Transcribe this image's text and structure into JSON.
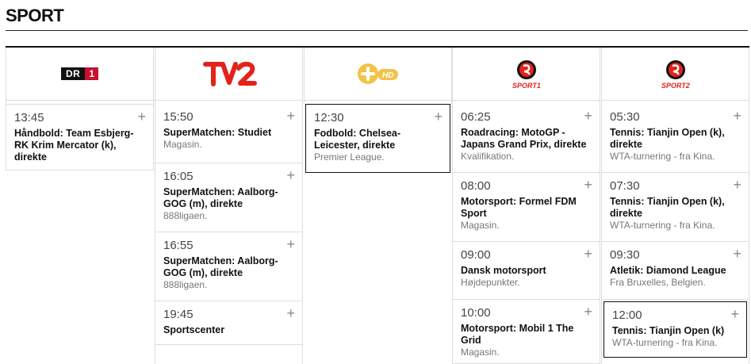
{
  "page": {
    "title": "SPORT"
  },
  "channels": [
    {
      "name": "DR1",
      "logo_text": "DR",
      "logo_num": "1"
    },
    {
      "name": "TV2",
      "logo_text": "TV2"
    },
    {
      "name": "3+ HD",
      "logo_text": "3",
      "logo_sub": "HD"
    },
    {
      "name": "TV3 Sport 1",
      "logo_text": "SPORT1"
    },
    {
      "name": "TV3 Sport 2",
      "logo_text": "SPORT2"
    }
  ],
  "schedule": {
    "dr1": [
      {
        "time": "13:45",
        "name": "Håndbold: Team Esbjerg-RK Krim Mercator (k), direkte",
        "desc": ""
      }
    ],
    "tv2": [
      {
        "time": "15:50",
        "name": "SuperMatchen: Studiet",
        "desc": "Magasin."
      },
      {
        "time": "16:05",
        "name": "SuperMatchen: Aalborg-GOG (m), direkte",
        "desc": "888ligaen."
      },
      {
        "time": "16:55",
        "name": "SuperMatchen: Aalborg-GOG (m), direkte",
        "desc": "888ligaen."
      },
      {
        "time": "19:45",
        "name": "Sportscenter",
        "desc": ""
      }
    ],
    "threeplus": [
      {
        "time": "12:30",
        "name": "Fodbold: Chelsea-Leicester, direkte",
        "desc": "Premier League."
      }
    ],
    "sport1": [
      {
        "time": "06:25",
        "name": "Roadracing: MotoGP - Japans Grand Prix, direkte",
        "desc": "Kvalifikation."
      },
      {
        "time": "08:00",
        "name": "Motorsport: Formel FDM Sport",
        "desc": "Magasin."
      },
      {
        "time": "09:00",
        "name": "Dansk motorsport",
        "desc": "Højdepunkter."
      },
      {
        "time": "10:00",
        "name": "Motorsport: Mobil 1 The Grid",
        "desc": "Magasin."
      }
    ],
    "sport2": [
      {
        "time": "05:30",
        "name": "Tennis: Tianjin Open (k), direkte",
        "desc": "WTA-turnering - fra Kina."
      },
      {
        "time": "07:30",
        "name": "Tennis: Tianjin Open (k), direkte",
        "desc": "WTA-turnering - fra Kina."
      },
      {
        "time": "09:30",
        "name": "Atletik: Diamond League",
        "desc": "Fra Bruxelles, Belgien."
      },
      {
        "time": "12:00",
        "name": "Tennis: Tianjin Open (k)",
        "desc": "WTA-turnering - fra Kina."
      }
    ]
  },
  "icons": {
    "add": "plus-icon"
  },
  "colors": {
    "accent_red": "#c8102e",
    "text": "#111111",
    "muted": "#777777",
    "border": "#dddddd"
  },
  "ui": {
    "plus": "+"
  }
}
